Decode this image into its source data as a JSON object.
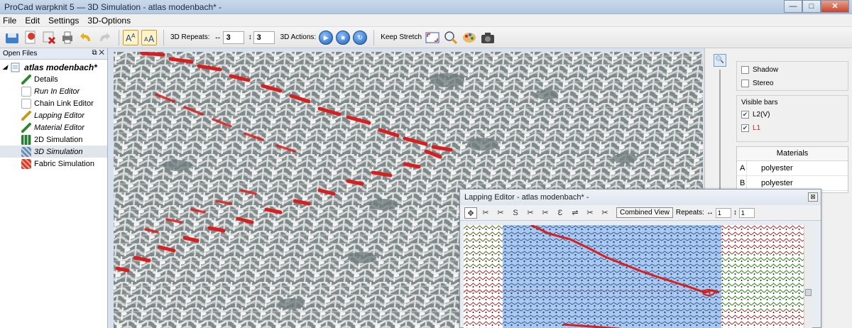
{
  "window": {
    "title": "ProCad warpknit 5 — 3D Simulation - atlas modenbach* -",
    "minimize": "—",
    "maximize": "□",
    "close": "✕"
  },
  "menu": [
    "File",
    "Edit",
    "Settings",
    "3D-Options"
  ],
  "toolbar": {
    "repeats_label": "3D Repeats:",
    "repeat_h_icon": "↔",
    "repeat_h": "3",
    "repeat_v_icon": "↕",
    "repeat_v": "3",
    "actions_label": "3D Actions:",
    "keep_stretch": "Keep Stretch"
  },
  "left_panel": {
    "header": "Open Files",
    "header_ctrls": "⧉ ✕",
    "root": "atlas modenbach*",
    "items": [
      {
        "label": "Details",
        "italic": false
      },
      {
        "label": "Run In Editor",
        "italic": true
      },
      {
        "label": "Chain Link Editor",
        "italic": false
      },
      {
        "label": "Lapping Editor",
        "italic": true
      },
      {
        "label": "Material Editor",
        "italic": true
      },
      {
        "label": "2D Simulation",
        "italic": false
      },
      {
        "label": "3D Simulation",
        "italic": true,
        "selected": true
      },
      {
        "label": "Fabric Simulation",
        "italic": false
      }
    ]
  },
  "right_panel": {
    "shadow": "Shadow",
    "stereo": "Stereo",
    "visible_bars_title": "Visible bars",
    "bar1": "L2(V)",
    "bar2": "L1",
    "bar2_color": "#cc2020",
    "materials_header": "Materials",
    "materials": [
      {
        "key": "A",
        "value": "polyester"
      },
      {
        "key": "B",
        "value": "polyester"
      }
    ]
  },
  "lapping_editor": {
    "title": "Lapping Editor - atlas modenbach* -",
    "combined_view": "Combined View",
    "repeats_label": "Repeats:",
    "rep_h_icon": "↔",
    "rep_h": "1",
    "rep_v_icon": "↕",
    "rep_v": "1"
  },
  "colors": {
    "stitch_red": "#d42020",
    "yarn_white": "#e8e8e8",
    "background": "#7a8687",
    "lap_blue": "#a9c9f0",
    "lap_green": "#2aa22a"
  }
}
